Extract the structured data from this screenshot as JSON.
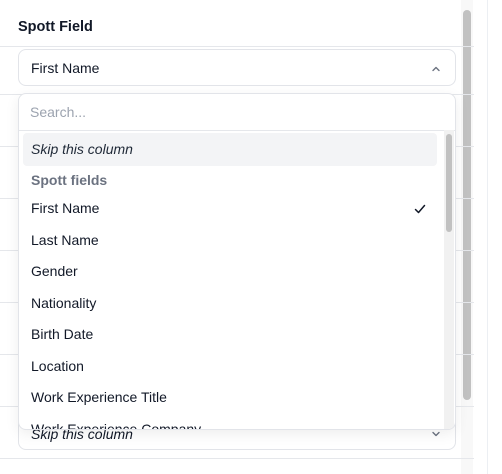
{
  "header": {
    "title": "Spott Field"
  },
  "select": {
    "value": "First Name",
    "below_value": "Skip this column"
  },
  "dropdown": {
    "search_placeholder": "Search...",
    "skip_label": "Skip this column",
    "group_label": "Spott fields",
    "options": [
      {
        "label": "First Name",
        "selected": true
      },
      {
        "label": "Last Name"
      },
      {
        "label": "Gender"
      },
      {
        "label": "Nationality"
      },
      {
        "label": "Birth Date"
      },
      {
        "label": "Location"
      },
      {
        "label": "Work Experience Title"
      },
      {
        "label": "Work Experience Company"
      }
    ]
  },
  "icons": {
    "trigger": "chevron-up-icon",
    "below": "chevron-down-icon",
    "selected": "check-icon"
  }
}
